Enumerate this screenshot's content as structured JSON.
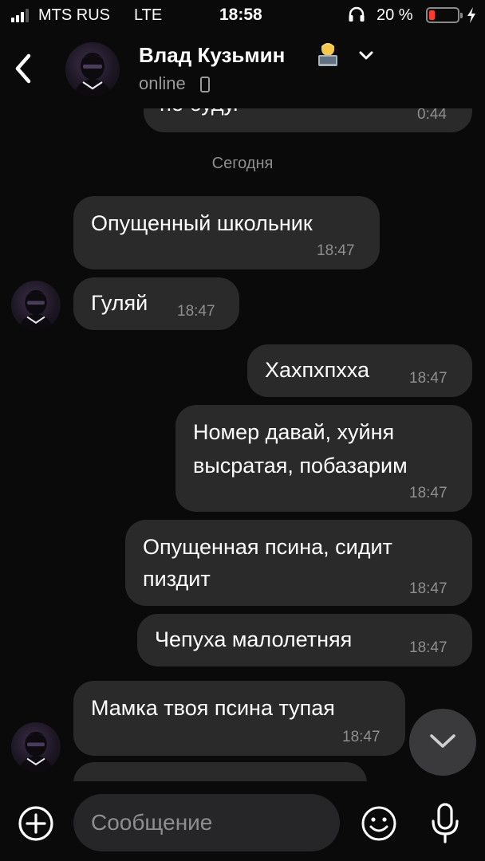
{
  "status_bar": {
    "carrier": "MTS RUS",
    "network": "LTE",
    "time": "18:58",
    "battery_percent": "20 %",
    "battery_level": 0.2,
    "battery_color": "#ff3b30"
  },
  "header": {
    "back_icon": "chevron-left-icon",
    "contact_name": "Влад Кузьмин",
    "emoji_icon": "technologist-emoji",
    "menu_icon": "chevron-down-icon",
    "status": "online",
    "device_icon": "phone-icon"
  },
  "chat": {
    "partial_message": {
      "text": "не буду.",
      "time": "0:44"
    },
    "date_separator": "Сегодня",
    "messages": [
      {
        "direction": "incoming",
        "text": "Опущенный школьник",
        "time": "18:47"
      },
      {
        "direction": "incoming",
        "text": "Гуляй",
        "time": "18:47"
      },
      {
        "direction": "outgoing",
        "text": "Хахпхпхха",
        "time": "18:47"
      },
      {
        "direction": "outgoing",
        "text_lines": [
          "Номер давай, хуйня",
          "высратая, побазарим"
        ],
        "time": "18:47"
      },
      {
        "direction": "outgoing",
        "text_lines": [
          "Опущенная псина, сидит",
          "пиздит"
        ],
        "time": "18:47"
      },
      {
        "direction": "outgoing",
        "text": "Чепуха малолетняя",
        "time": "18:47"
      },
      {
        "direction": "incoming",
        "text": "Мамка твоя псина тупая",
        "time": "18:47"
      }
    ]
  },
  "composer": {
    "placeholder": "Сообщение",
    "attach_icon": "plus-circle-icon",
    "emoji_icon": "smiley-icon",
    "voice_icon": "microphone-icon",
    "scroll_icon": "chevron-down-icon"
  },
  "colors": {
    "background": "#0a0a0a",
    "bubble": "#2a2a2b",
    "secondary_text": "#8e8e90"
  }
}
